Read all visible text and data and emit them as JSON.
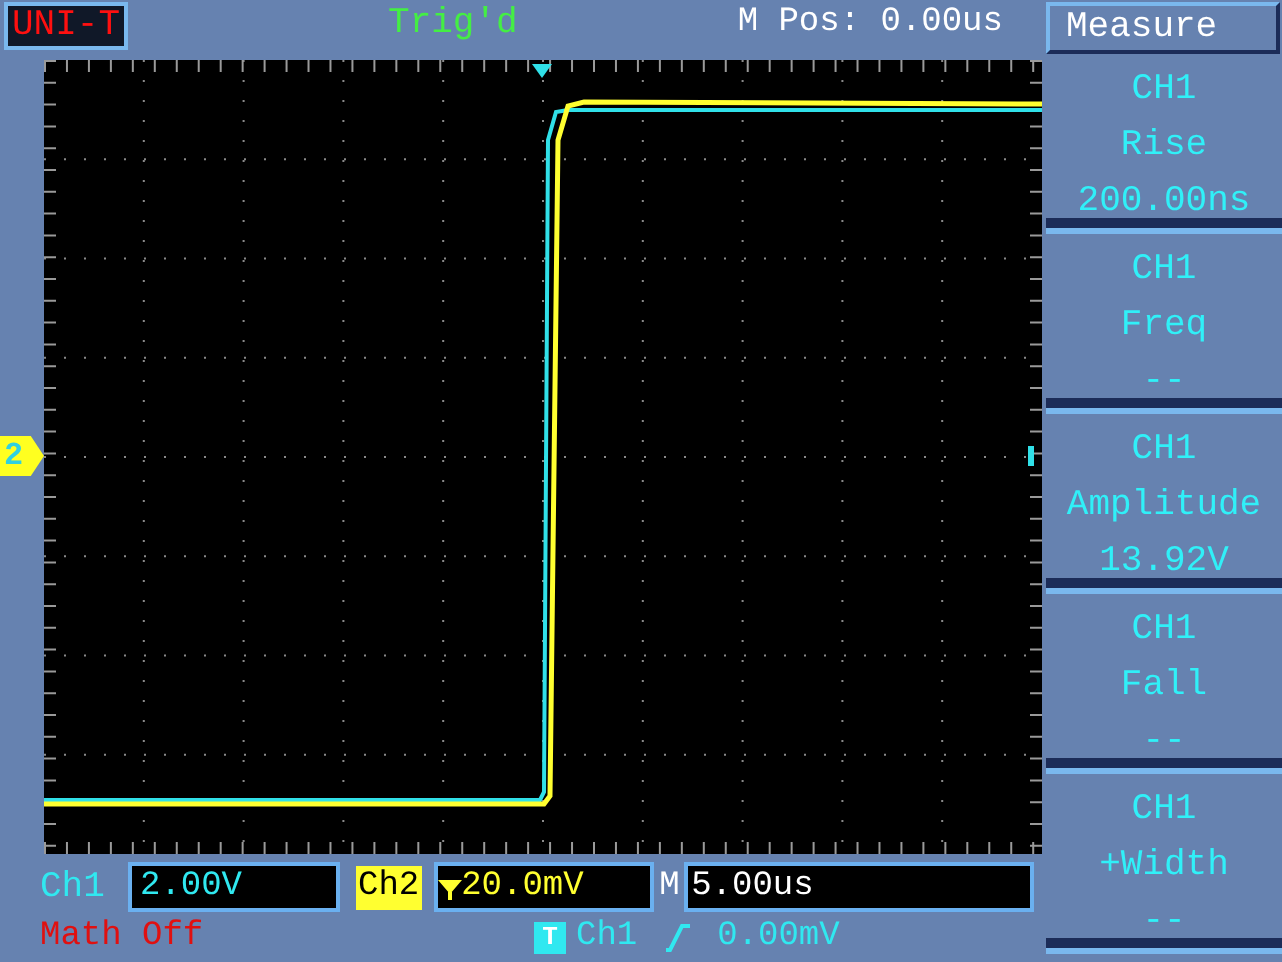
{
  "header": {
    "brand": "UNI-T",
    "trigger_status": "Trig'd",
    "position": "M Pos: 0.00us"
  },
  "menu": {
    "title": "Measure",
    "items": [
      {
        "channel": "CH1",
        "measurement": "Rise",
        "value": "200.00ns"
      },
      {
        "channel": "CH1",
        "measurement": "Freq",
        "value": "--"
      },
      {
        "channel": "CH1",
        "measurement": "Amplitude",
        "value": "13.92V"
      },
      {
        "channel": "CH1",
        "measurement": "Fall",
        "value": "--"
      },
      {
        "channel": "CH1",
        "measurement": "+Width",
        "value": "--"
      }
    ]
  },
  "channel_marker": {
    "label": "2"
  },
  "status": {
    "ch1_label": "Ch1",
    "ch1_scale": "2.00V",
    "ch2_label": "Ch2",
    "ch2_scale": "20.0mV",
    "timebase_label": "M",
    "timebase": "5.00us",
    "math": "Math Off",
    "trigger_label": "T",
    "trigger_source": "Ch1",
    "trigger_level": "0.00mV"
  }
}
